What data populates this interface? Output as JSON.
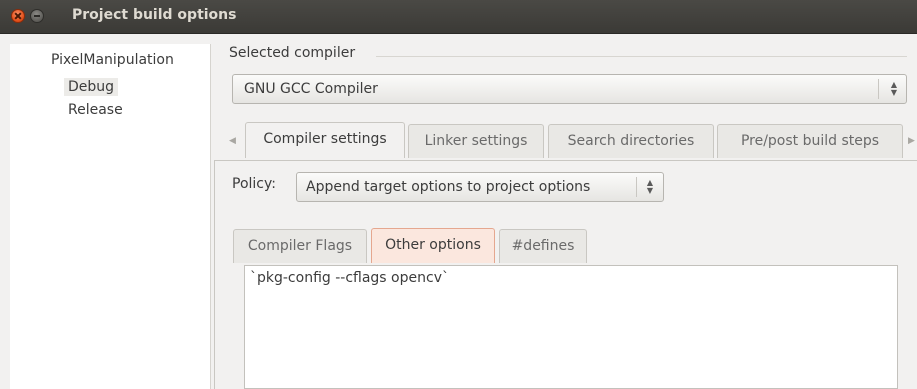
{
  "window": {
    "title": "Project build options"
  },
  "tree": {
    "root": "PixelManipulation",
    "items": [
      "Debug",
      "Release"
    ],
    "selected": "Debug"
  },
  "compiler": {
    "group_label": "Selected compiler",
    "selected": "GNU GCC Compiler"
  },
  "main_tabs": [
    "Compiler settings",
    "Linker settings",
    "Search directories",
    "Pre/post build steps"
  ],
  "policy": {
    "label": "Policy:",
    "selected": "Append target options to project options"
  },
  "inner_tabs": [
    "Compiler Flags",
    "Other options",
    "#defines"
  ],
  "other_options": {
    "text": "`pkg-config --cflags opencv`"
  },
  "colors": {
    "titlebar": "#3c3b37",
    "accent_tab_bg": "#fbe7de",
    "accent_tab_border": "#e5a78f",
    "close_button": "#e5531d"
  }
}
